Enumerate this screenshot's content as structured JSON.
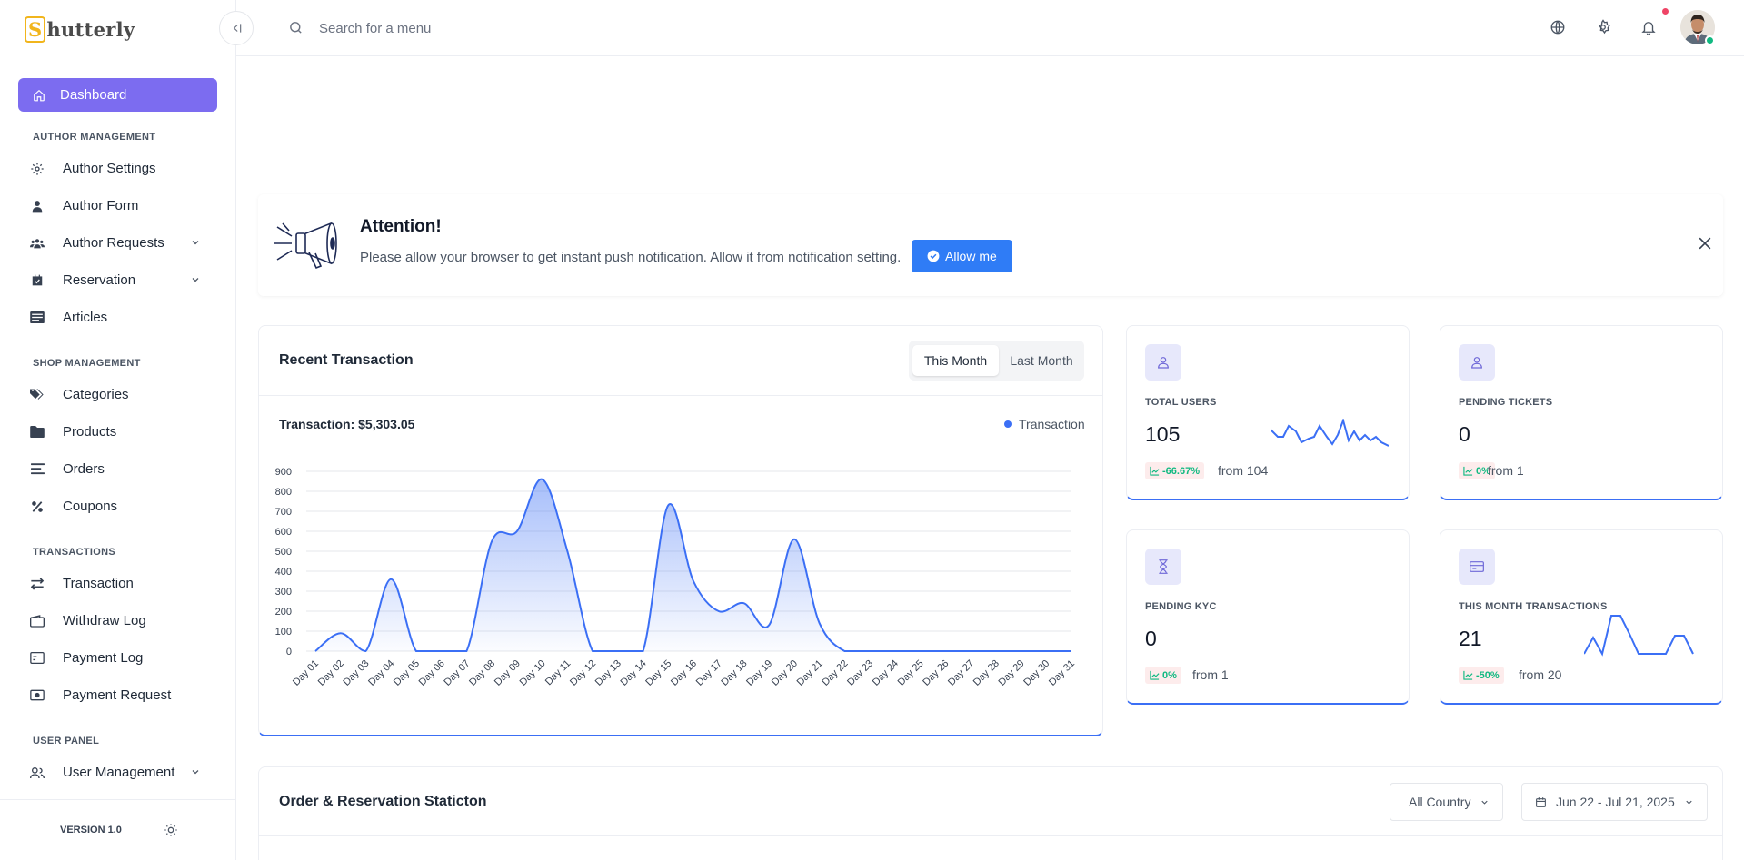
{
  "brand": {
    "name": "Shutterly"
  },
  "search": {
    "placeholder": "Search for a menu"
  },
  "sidebar": {
    "active": {
      "label": "Dashboard",
      "icon": "home-icon"
    },
    "sections": {
      "author": "AUTHOR MANAGEMENT",
      "shop": "SHOP MANAGEMENT",
      "transactions": "TRANSACTIONS",
      "user": "USER PANEL"
    },
    "items": [
      {
        "label": "Author Settings",
        "icon": "gear-icon"
      },
      {
        "label": "Author Form",
        "icon": "user-icon"
      },
      {
        "label": "Author Requests",
        "icon": "users-icon"
      },
      {
        "label": "Reservation",
        "icon": "calendar-check-icon"
      },
      {
        "label": "Articles",
        "icon": "articles-icon"
      },
      {
        "label": "Categories",
        "icon": "tags-icon"
      },
      {
        "label": "Products",
        "icon": "folder-icon"
      },
      {
        "label": "Orders",
        "icon": "list-icon"
      },
      {
        "label": "Coupons",
        "icon": "percent-icon"
      },
      {
        "label": "Transaction",
        "icon": "exchange-icon"
      },
      {
        "label": "Withdraw Log",
        "icon": "wallet-icon"
      },
      {
        "label": "Payment Log",
        "icon": "payment-log-icon"
      },
      {
        "label": "Payment Request",
        "icon": "money-icon"
      },
      {
        "label": "User Management",
        "icon": "user-group-icon"
      }
    ],
    "version": "VERSION 1.0"
  },
  "attention": {
    "title": "Attention!",
    "text": "Please allow your browser to get instant push notification. Allow it from notification setting.",
    "button": "Allow me"
  },
  "transaction": {
    "title": "Recent Transaction",
    "tab_active": "This Month",
    "tab_other": "Last Month",
    "total": "Transaction: $5,303.05",
    "legend": "Transaction"
  },
  "stats": [
    {
      "label": "TOTAL USERS",
      "value": "105",
      "badge": "-66.67%",
      "from": "from 104"
    },
    {
      "label": "PENDING TICKETS",
      "value": "0",
      "badge": "0%",
      "from": "from 1"
    },
    {
      "label": "PENDING KYC",
      "value": "0",
      "badge": "0%",
      "from": "from 1"
    },
    {
      "label": "THIS MONTH TRANSACTIONS",
      "value": "21",
      "badge": "-50%",
      "from": "from 20"
    }
  ],
  "order": {
    "title": "Order & Reservation Staticton",
    "country": "All Country",
    "date_range": "Jun 22 - Jul 21, 2025"
  },
  "colors": {
    "accent": "#7c6cf0",
    "primary": "#3b6ff5",
    "button": "#2f7cf6",
    "success": "#10b981"
  },
  "chart_data": {
    "type": "area",
    "categories": [
      "Day 01",
      "Day 02",
      "Day 03",
      "Day 04",
      "Day 05",
      "Day 06",
      "Day 07",
      "Day 08",
      "Day 09",
      "Day 10",
      "Day 11",
      "Day 12",
      "Day 13",
      "Day 14",
      "Day 15",
      "Day 16",
      "Day 17",
      "Day 18",
      "Day 19",
      "Day 20",
      "Day 21",
      "Day 22",
      "Day 23",
      "Day 24",
      "Day 25",
      "Day 26",
      "Day 27",
      "Day 28",
      "Day 29",
      "Day 30",
      "Day 31"
    ],
    "series": [
      {
        "name": "Transaction",
        "values": [
          0,
          90,
          0,
          360,
          0,
          0,
          0,
          550,
          600,
          860,
          500,
          0,
          0,
          0,
          730,
          350,
          200,
          240,
          130,
          560,
          140,
          0,
          0,
          0,
          0,
          0,
          0,
          0,
          0,
          0,
          0
        ]
      }
    ],
    "yticks": [
      0,
      100,
      200,
      300,
      400,
      500,
      600,
      700,
      800,
      900
    ],
    "ylim": [
      0,
      900
    ],
    "grid": true,
    "legend": "top-right"
  }
}
